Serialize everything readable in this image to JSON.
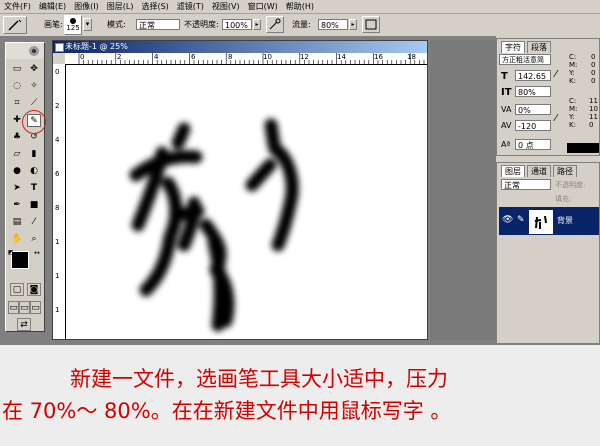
{
  "menubar": {
    "items": [
      "文件(F)",
      "编辑(E)",
      "图像(I)",
      "图层(L)",
      "选择(S)",
      "滤镜(T)",
      "视图(V)",
      "窗口(W)",
      "帮助(H)"
    ]
  },
  "options": {
    "brush_label": "画笔:",
    "brush_size": "125",
    "mode_label": "模式:",
    "mode_value": "正常",
    "opacity_label": "不透明度:",
    "opacity_value": "100%",
    "flow_label": "流量:",
    "flow_value": "80%"
  },
  "palette_well": {
    "label": "画笔"
  },
  "document": {
    "title": "未标题-1 @ 25%",
    "ruler_ticks": [
      "0",
      "2",
      "4",
      "6",
      "8",
      "10",
      "12",
      "14",
      "16",
      "18"
    ],
    "ruler_side_ticks": [
      "0",
      "2",
      "4",
      "6",
      "8",
      "1",
      "1",
      "1",
      "1"
    ]
  },
  "character_panel": {
    "tab_character": "字符",
    "tab_paragraph": "段落",
    "font_name": "方正粗活意简",
    "font_size": "142.65",
    "leading": "80%",
    "tracking_a": "0%",
    "tracking_b": "-120",
    "baseline": "0 点"
  },
  "color_panel": {
    "labels": [
      "C:",
      "M:",
      "Y:",
      "K:"
    ],
    "values": [
      "0",
      "0",
      "0",
      "0"
    ],
    "labels2": [
      "C:",
      "M:",
      "Y:",
      "K:"
    ],
    "values2": [
      "11",
      "10",
      "11",
      "0"
    ]
  },
  "layers_panel": {
    "tab_layers": "图层",
    "tab_channels": "通道",
    "tab_paths": "路径",
    "blend_mode": "正常",
    "opacity_label": "不透明度:",
    "fill_label": "填充:",
    "layer_name": "背景"
  },
  "caption": {
    "line1": "新建一文件，选画笔工具大小适中，压力",
    "line2": "在 70%～ 80%。在在新建文件中用鼠标写字 。"
  },
  "colors": {
    "ui_gray": "#d4d0c8",
    "caption_red": "#d40000",
    "title_blue": "#0a246a"
  }
}
